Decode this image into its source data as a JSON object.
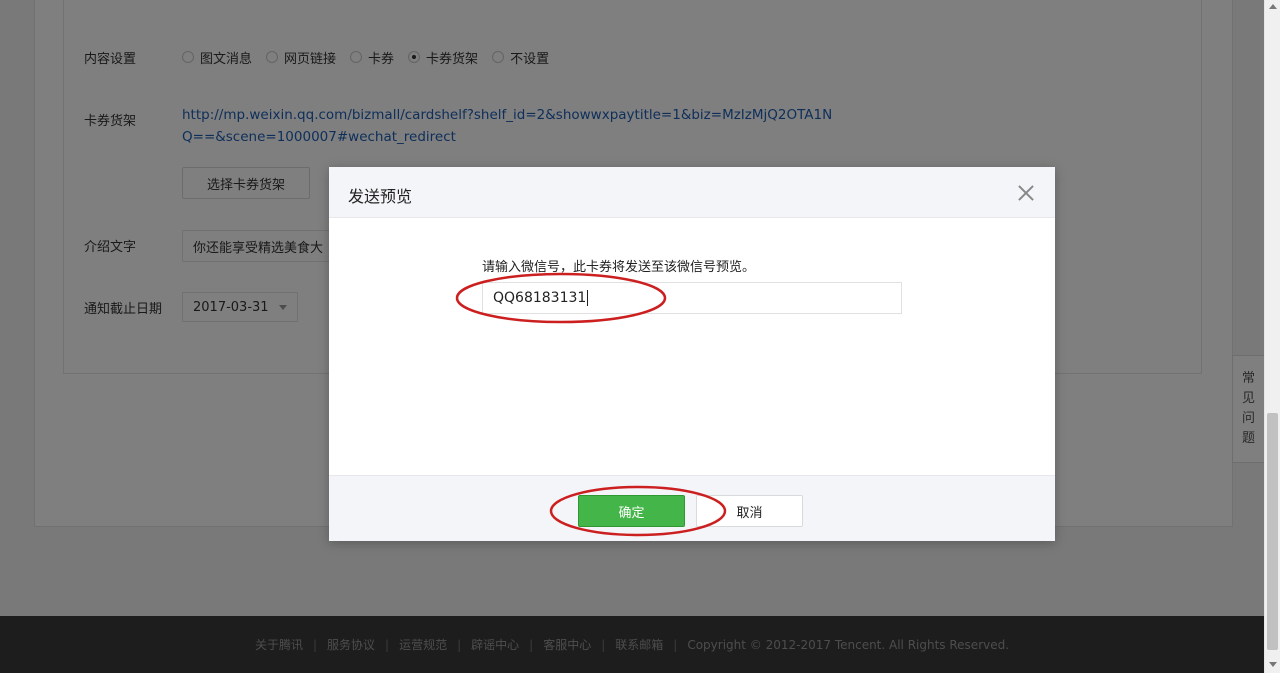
{
  "form": {
    "content_label": "内容设置",
    "content_options": [
      {
        "label": "图文消息",
        "checked": false
      },
      {
        "label": "网页链接",
        "checked": false
      },
      {
        "label": "卡券",
        "checked": false
      },
      {
        "label": "卡券货架",
        "checked": true
      },
      {
        "label": "不设置",
        "checked": false
      }
    ],
    "shelf_label": "卡券货架",
    "shelf_link": "http://mp.weixin.qq.com/bizmall/cardshelf?shelf_id=2&showwxpaytitle=1&biz=MzIzMjQ2OTA1NQ==&scene=1000007#wechat_redirect",
    "choose_shelf_button": "选择卡券货架",
    "intro_label": "介绍文字",
    "intro_value": "你还能享受精选美食大",
    "deadline_label": "通知截止日期",
    "deadline_value": "2017-03-31"
  },
  "help_tab": [
    "常",
    "见",
    "问",
    "题"
  ],
  "footer": {
    "links": [
      "关于腾讯",
      "服务协议",
      "运营规范",
      "辟谣中心",
      "客服中心",
      "联系邮箱"
    ],
    "copyright": "Copyright © 2012-2017 Tencent. All Rights Reserved."
  },
  "dialog": {
    "title": "发送预览",
    "prompt": "请输入微信号，此卡券将发送至该微信号预览。",
    "input_value": "QQ68183131",
    "confirm_label": "确定",
    "cancel_label": "取消"
  },
  "colors": {
    "primary": "#44b549",
    "link": "#1e5eb5",
    "annotation": "#cc1f1f"
  }
}
